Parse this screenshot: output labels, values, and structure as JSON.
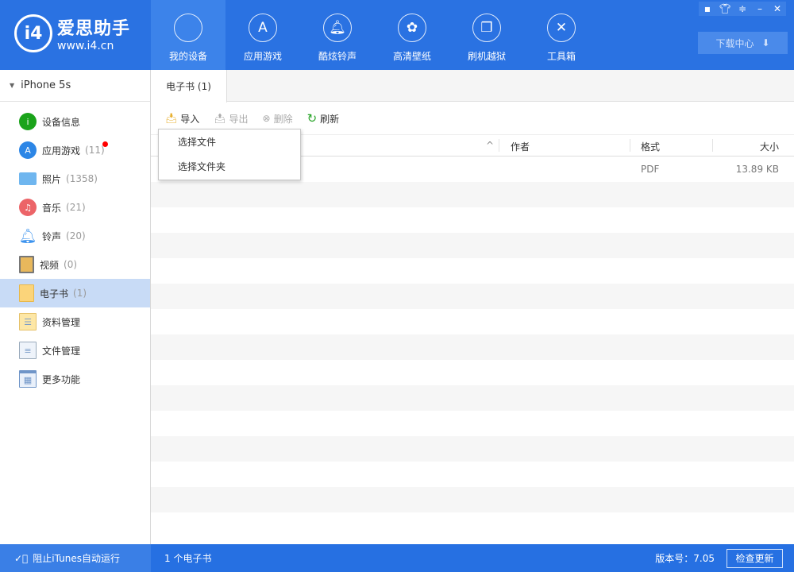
{
  "app": {
    "logo_name": "爱思助手",
    "logo_url": "www.i4.cn",
    "logo_mark": "i4"
  },
  "nav": [
    {
      "label": "我的设备"
    },
    {
      "label": "应用游戏"
    },
    {
      "label": "酷炫铃声"
    },
    {
      "label": "高清壁纸"
    },
    {
      "label": "刷机越狱"
    },
    {
      "label": "工具箱"
    }
  ],
  "download_center": "下载中心",
  "sidebar": {
    "device": "iPhone 5s",
    "items": [
      {
        "label": "设备信息",
        "count": ""
      },
      {
        "label": "应用游戏",
        "count": "(11)"
      },
      {
        "label": "照片",
        "count": "(1358)"
      },
      {
        "label": "音乐",
        "count": "(21)"
      },
      {
        "label": "铃声",
        "count": "(20)"
      },
      {
        "label": "视频",
        "count": "(0)"
      },
      {
        "label": "电子书",
        "count": "(1)"
      },
      {
        "label": "资料管理",
        "count": ""
      },
      {
        "label": "文件管理",
        "count": ""
      },
      {
        "label": "更多功能",
        "count": ""
      }
    ]
  },
  "tab": "电子书 (1)",
  "toolbar": {
    "import": "导入",
    "export": "导出",
    "delete": "删除",
    "refresh": "刷新"
  },
  "menu": [
    "选择文件",
    "选择文件夹"
  ],
  "table": {
    "headers": {
      "author": "作者",
      "format": "格式",
      "size": "大小"
    },
    "rows": [
      {
        "format": "PDF",
        "size": "13.89 KB"
      }
    ]
  },
  "footer": {
    "itunes": "阻止iTunes自动运行",
    "count": "1 个电子书",
    "version": "版本号：7.05",
    "update": "检查更新"
  },
  "colors": {
    "brand": "#2a72e2",
    "selected": "#c8dbf6"
  }
}
